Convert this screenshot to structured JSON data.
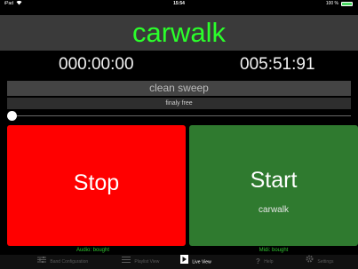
{
  "status_bar": {
    "device": "iPad",
    "time": "15:54",
    "battery": "100 %"
  },
  "track_title": "carwalk",
  "timers": {
    "elapsed": "000:00:00",
    "total": "005:51:91"
  },
  "cue_name": "clean sweep",
  "next_cue": "finaly free",
  "playback_progress": 0,
  "buttons": {
    "stop_label": "Stop",
    "start_label": "Start",
    "start_sub": "carwalk"
  },
  "status": {
    "audio": "Audio: bought",
    "midi": "Midi: bought"
  },
  "tabs": [
    {
      "label": "Band Configuration",
      "icon": "sliders-icon",
      "active": false
    },
    {
      "label": "Playlist View",
      "icon": "list-icon",
      "active": false
    },
    {
      "label": "Live View",
      "icon": "play-icon",
      "active": true
    },
    {
      "label": "Help",
      "icon": "question-icon",
      "active": false
    },
    {
      "label": "Settings",
      "icon": "gear-icon",
      "active": false
    }
  ],
  "colors": {
    "title": "#2bff2b",
    "stop": "#ff0000",
    "start": "#2f7a2f",
    "status_text": "#2fc42f"
  }
}
